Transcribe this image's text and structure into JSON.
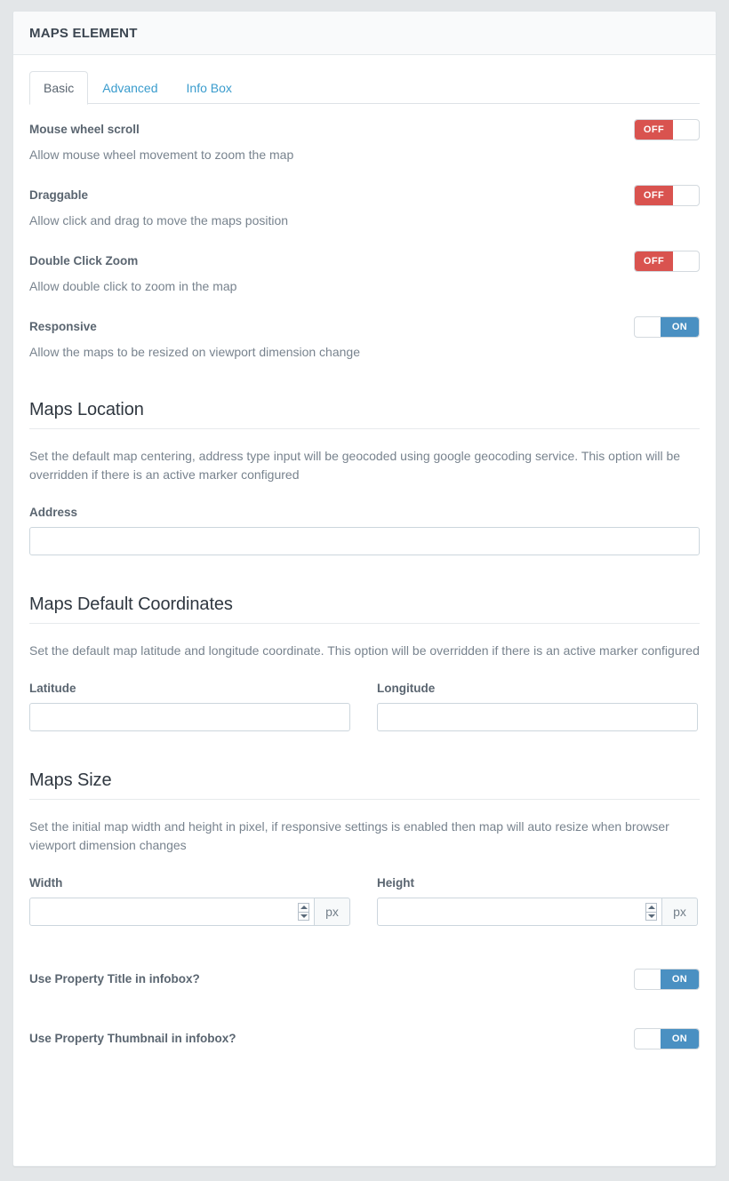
{
  "panel": {
    "title": "MAPS ELEMENT"
  },
  "tabs": [
    {
      "label": "Basic",
      "active": true
    },
    {
      "label": "Advanced",
      "active": false
    },
    {
      "label": "Info Box",
      "active": false
    }
  ],
  "basic_options": [
    {
      "label": "Mouse wheel scroll",
      "help": "Allow mouse wheel movement to zoom the map",
      "state": "OFF"
    },
    {
      "label": "Draggable",
      "help": "Allow click and drag to move the maps position",
      "state": "OFF"
    },
    {
      "label": "Double Click Zoom",
      "help": "Allow double click to zoom in the map",
      "state": "OFF"
    },
    {
      "label": "Responsive",
      "help": "Allow the maps to be resized on viewport dimension change",
      "state": "ON"
    }
  ],
  "maps_location": {
    "title": "Maps Location",
    "description": "Set the default map centering, address type input will be geocoded using google geocoding service. This option will be overridden if there is an active marker configured",
    "address": {
      "label": "Address",
      "value": "",
      "placeholder": ""
    }
  },
  "maps_default_coordinates": {
    "title": "Maps Default Coordinates",
    "description": "Set the default map latitude and longitude coordinate. This option will be overridden if there is an active marker configured",
    "latitude": {
      "label": "Latitude",
      "value": "",
      "placeholder": ""
    },
    "longitude": {
      "label": "Longitude",
      "value": "",
      "placeholder": ""
    }
  },
  "maps_size": {
    "title": "Maps Size",
    "description": "Set the initial map width and height in pixel, if responsive settings is enabled then map will auto resize when browser viewport dimension changes",
    "width": {
      "label": "Width",
      "value": "",
      "placeholder": "",
      "unit": "px"
    },
    "height": {
      "label": "Height",
      "value": "",
      "placeholder": "",
      "unit": "px"
    }
  },
  "infobox_options": [
    {
      "label": "Use Property Title in infobox?",
      "state": "ON"
    },
    {
      "label": "Use Property Thumbnail in infobox?",
      "state": "ON"
    }
  ],
  "colors": {
    "off": "#d9534f",
    "on": "#4a90c2",
    "link": "#3a9ccd",
    "page_background": "#e3e6e8"
  }
}
